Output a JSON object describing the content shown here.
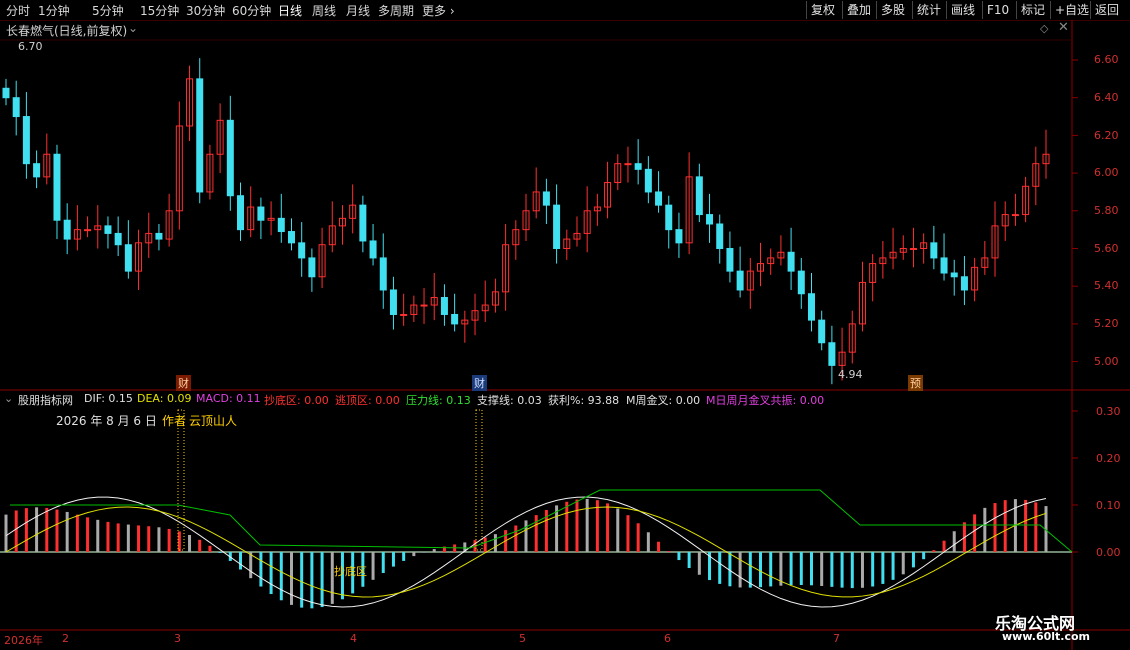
{
  "toolbar": {
    "periods": [
      "分时",
      "1分钟",
      "5分钟",
      "15分钟",
      "30分钟",
      "60分钟",
      "日线",
      "周线",
      "月线",
      "多周期",
      "更多"
    ],
    "active_period": "日线",
    "buttons": [
      "复权",
      "叠加",
      "多股",
      "统计",
      "画线",
      "F10",
      "标记",
      "+自选",
      "返回"
    ]
  },
  "main_chart": {
    "title": "长春燃气(日线,前复权)",
    "high_marker": "6.70",
    "low_marker": "4.94",
    "y_ticks": [
      "6.60",
      "6.40",
      "6.20",
      "6.00",
      "5.80",
      "5.60",
      "5.40",
      "5.20",
      "5.00"
    ],
    "badges": [
      "财",
      "财",
      "预"
    ]
  },
  "indicator": {
    "name": "股朋指标网",
    "values": [
      {
        "label": "DIF: 0.15",
        "color": "#e0e0e0"
      },
      {
        "label": "DEA: 0.09",
        "color": "#e0e000"
      },
      {
        "label": "MACD: 0.11",
        "color": "#e040e0"
      },
      {
        "label": "抄底区: 0.00",
        "color": "#ff3030"
      },
      {
        "label": "逃顶区: 0.00",
        "color": "#ff3030"
      },
      {
        "label": "压力线: 0.13",
        "color": "#30e030"
      },
      {
        "label": "支撑线: 0.03",
        "color": "#e0e0e0"
      },
      {
        "label": "获利%: 93.88",
        "color": "#e0e0e0"
      },
      {
        "label": "M周金叉: 0.00",
        "color": "#e0e0e0"
      },
      {
        "label": "M日周月金叉共振: 0.00",
        "color": "#e040e0"
      }
    ],
    "date_text": "2026 年 8 月 6 日",
    "author_label": "作者",
    "author_name": "云顶山人",
    "signal_label": "抄底区",
    "y_ticks": [
      "0.30",
      "0.20",
      "0.10",
      "0.00"
    ]
  },
  "x_axis": {
    "labels": [
      "2026年",
      "2",
      "3",
      "4",
      "5",
      "6",
      "7"
    ]
  },
  "watermark": {
    "site": "乐淘公式网",
    "url": "www.60lt.com"
  },
  "colors": {
    "up": "#ff3030",
    "down": "#40e0f0",
    "grid": "#8b0000",
    "axis_text": "#d03030"
  }
}
